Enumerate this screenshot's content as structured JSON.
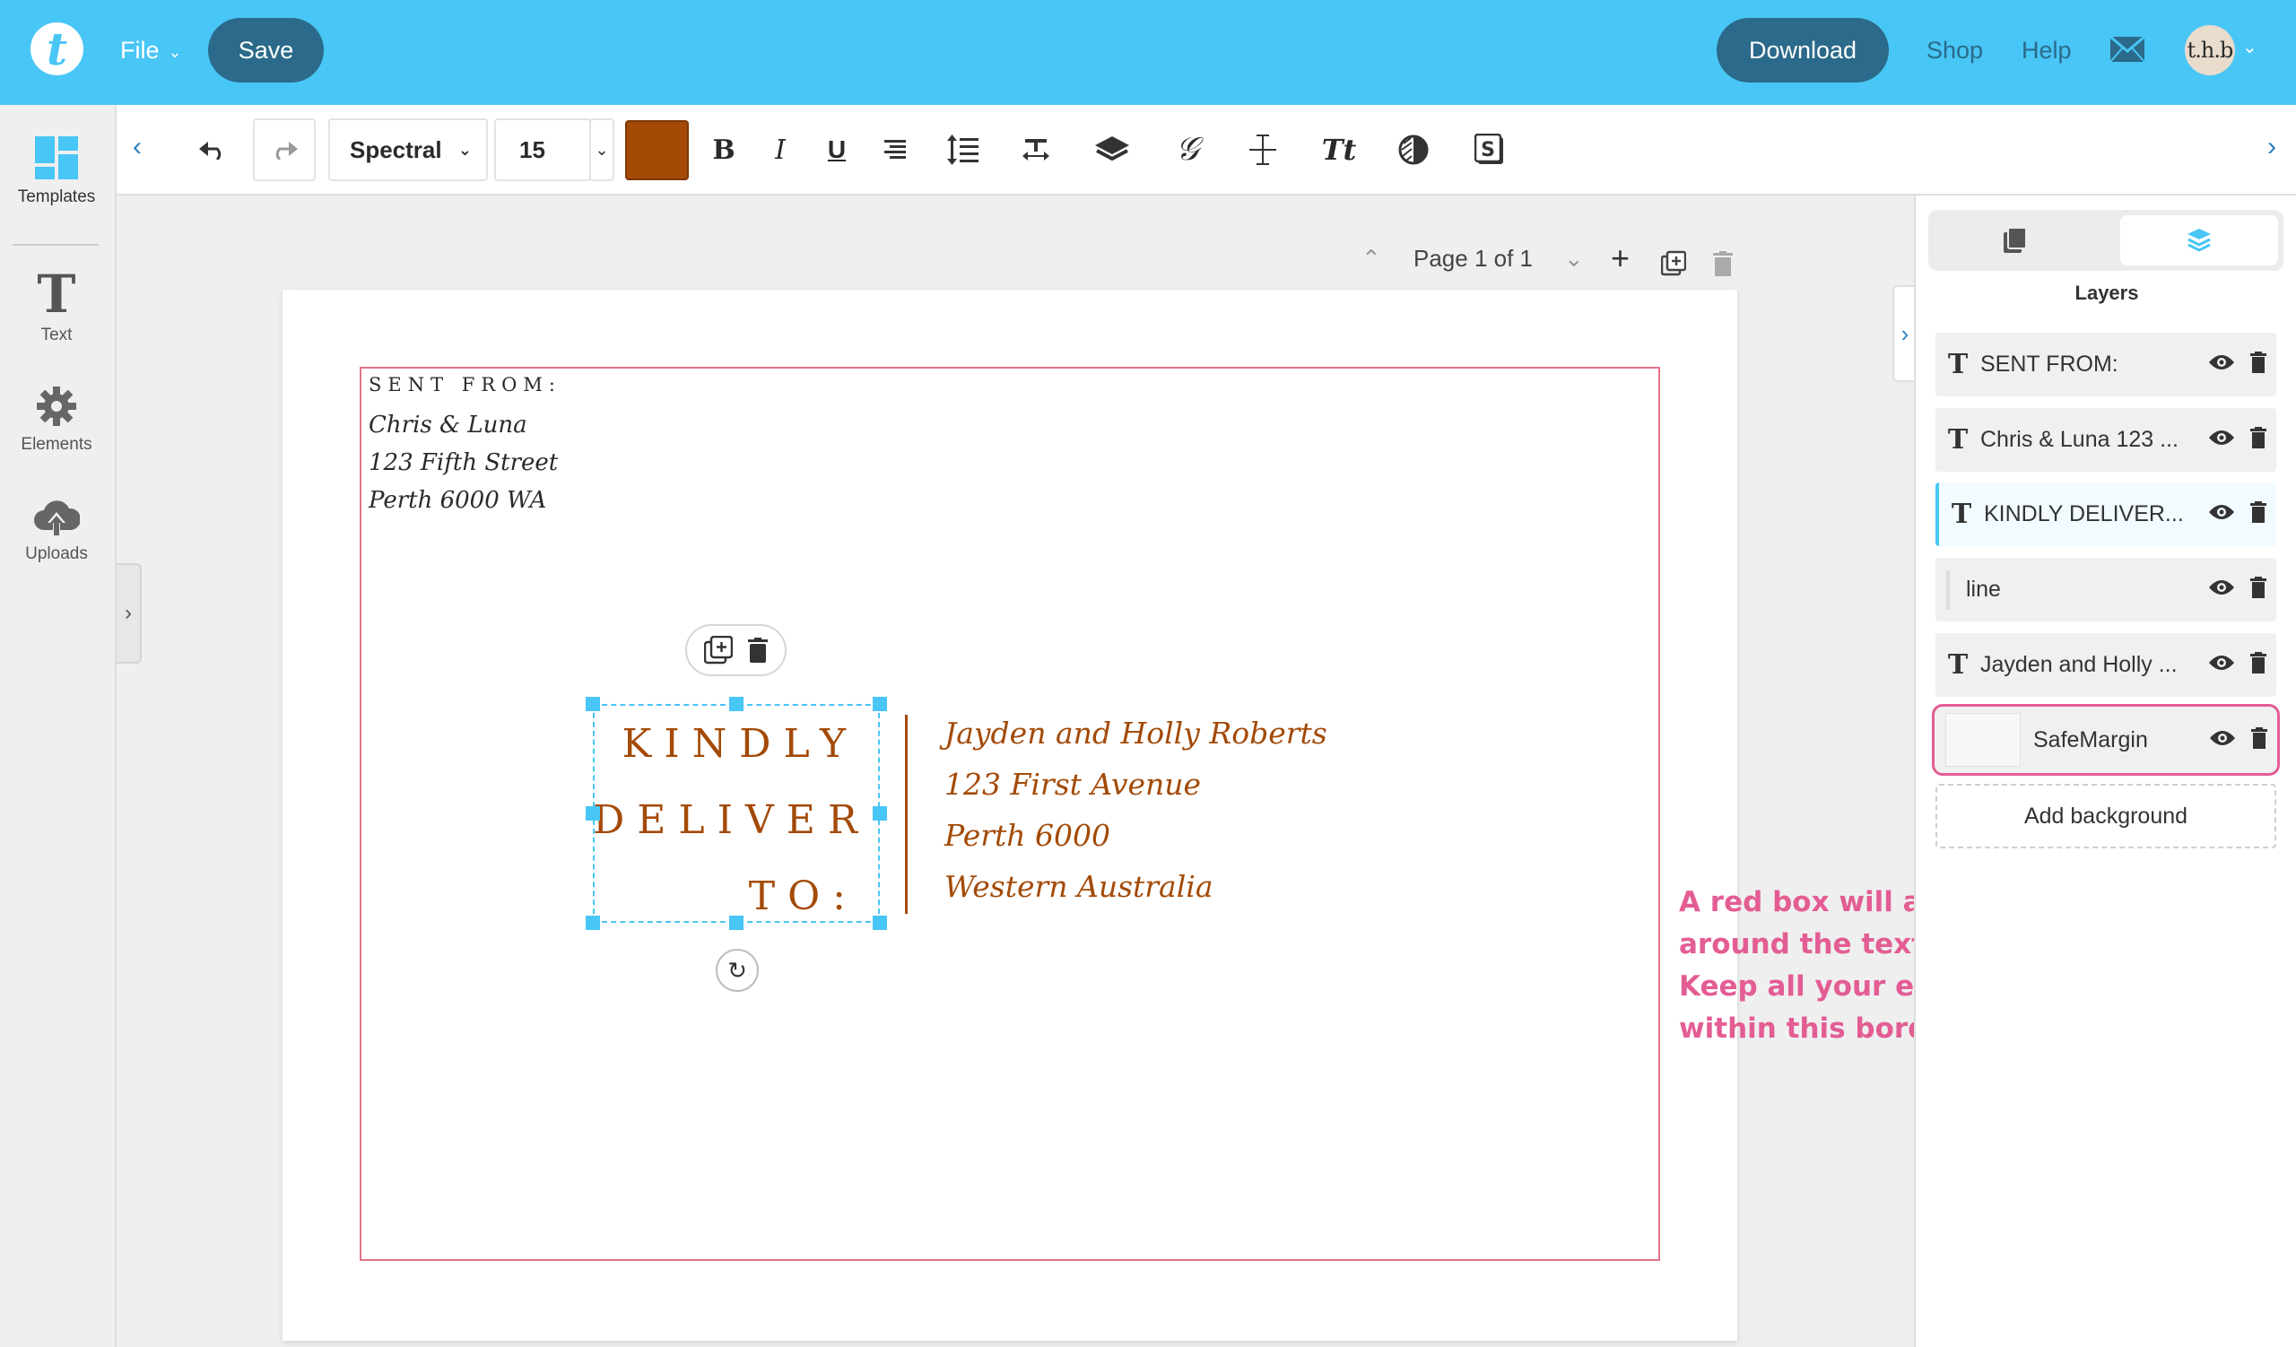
{
  "topbar": {
    "logo": "t",
    "file_label": "File",
    "save_label": "Save",
    "download_label": "Download",
    "shop_label": "Shop",
    "help_label": "Help",
    "avatar_text": "t.h.b",
    "accent_color": "#48c6f5",
    "button_color": "#2b6a8a"
  },
  "sidebar": {
    "items": [
      {
        "label": "Templates",
        "icon": "templates-icon"
      },
      {
        "label": "Text",
        "icon": "text-icon"
      },
      {
        "label": "Elements",
        "icon": "elements-icon"
      },
      {
        "label": "Uploads",
        "icon": "uploads-icon"
      }
    ]
  },
  "toolbar": {
    "font_family": "Spectral",
    "font_size": "15",
    "text_color": "#a34a07"
  },
  "page_nav": {
    "label": "Page 1 of 1"
  },
  "canvas": {
    "sent_from": "SENT FROM:",
    "sender": [
      "Chris & Luna",
      "123 Fifth Street",
      "Perth 6000 WA"
    ],
    "kindly_lines": [
      "KINDLY",
      "DELIVER",
      "TO:"
    ],
    "recipient": [
      "Jayden and Holly Roberts",
      "123 First Avenue",
      "Perth 6000",
      "Western Australia"
    ],
    "hint_lines": [
      "A red box will appear",
      "around the text.",
      "Keep all your elements",
      "within this border."
    ],
    "safe_margin_color": "#e3748a",
    "hint_color": "#e35d94"
  },
  "right_panel": {
    "title": "Layers",
    "layers": [
      {
        "name": "SENT FROM:",
        "type": "text"
      },
      {
        "name": "Chris & Luna 123 ...",
        "type": "text"
      },
      {
        "name": "KINDLY DELIVER...",
        "type": "text",
        "selected": true
      },
      {
        "name": "line",
        "type": "line"
      },
      {
        "name": "Jayden and Holly ...",
        "type": "text"
      },
      {
        "name": "SafeMargin",
        "type": "image"
      }
    ],
    "add_background_label": "Add background"
  }
}
